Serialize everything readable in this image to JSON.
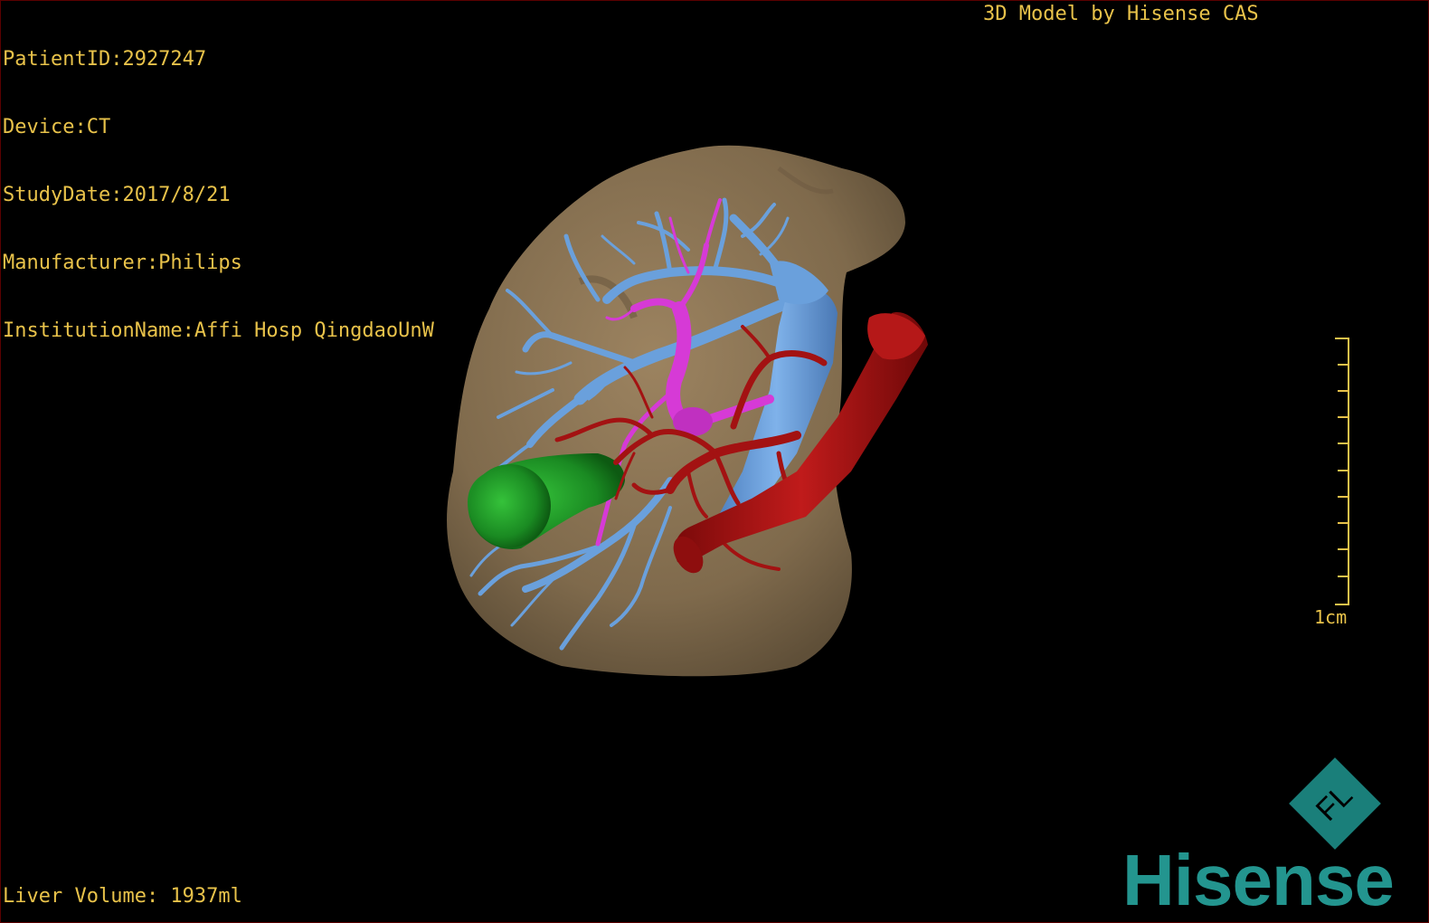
{
  "overlay": {
    "patient_id": "PatientID:2927247",
    "device": "Device:CT",
    "study_date": "StudyDate:2017/8/21",
    "manufacturer": "Manufacturer:Philips",
    "institution": "InstitutionName:Affi Hosp QingdaoUnW",
    "credit": "3D Model by Hisense CAS",
    "liver_volume": "Liver Volume: 1937ml"
  },
  "scale_bar": {
    "label": "1cm"
  },
  "logo": {
    "brand": "Hisense",
    "emblem_text": "FL"
  },
  "colors": {
    "overlay_text": "#e8c24a",
    "liver": "#8a7354",
    "hepatic_vein": "#6aa0dc",
    "portal_vein": "#d63ad6",
    "artery": "#a31212",
    "gallbladder": "#1f9a2a",
    "brand": "#23958f"
  }
}
